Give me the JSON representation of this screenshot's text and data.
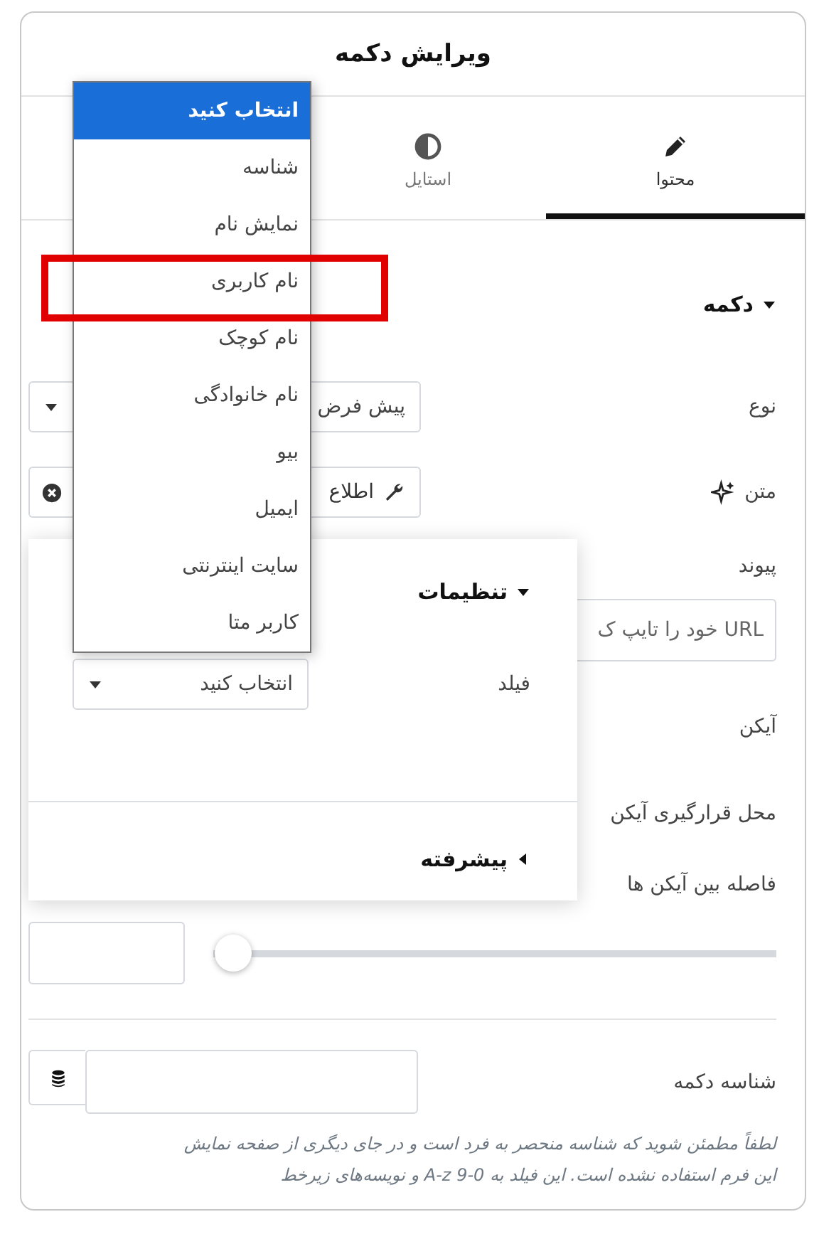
{
  "panel": {
    "title": "ویرایش دکمه"
  },
  "tabs": [
    {
      "label": "محتوا",
      "selected": true
    },
    {
      "label": "استایل",
      "selected": false
    }
  ],
  "section": {
    "title": "دکمه",
    "expanded": true
  },
  "type_field": {
    "label": "نوع",
    "value": "پیش فرض"
  },
  "text_field": {
    "label": "متن",
    "value": "اطلاع"
  },
  "link_field": {
    "label": "پیوند",
    "placeholder": "URL خود را تایپ ک"
  },
  "icon_label": "آیکن",
  "icon_position_label": "محل قرارگیری آیکن",
  "icon_spacing": {
    "label": "فاصله بین آیکن ها",
    "level": 0
  },
  "button_id": {
    "label": "شناسه دکمه",
    "help": "لطفاً مطمئن شوید که شناسه منحصر به فرد است و در جای دیگری از صفحه نمایش این فرم استفاده نشده است. این فیلد به 0-9  A-z و نویسه‌های زیرخط"
  },
  "popup": {
    "title": "تنظیمات",
    "expanded": true,
    "field_label": "فیلد",
    "field_value": "انتخاب کنید",
    "advanced": {
      "title": "پیشرفته",
      "expanded": false
    }
  },
  "dropdown": {
    "options": [
      {
        "label": "انتخاب کنید",
        "selected": true
      },
      {
        "label": "شناسه",
        "selected": false
      },
      {
        "label": "نمایش نام",
        "selected": false
      },
      {
        "label": "نام کاربری",
        "selected": false
      },
      {
        "label": "نام کوچک",
        "selected": false
      },
      {
        "label": "نام خانوادگی",
        "selected": false
      },
      {
        "label": "بیو",
        "selected": false
      },
      {
        "label": "ایمیل",
        "selected": false
      },
      {
        "label": "سایت اینترنتی",
        "selected": false
      },
      {
        "label": "کاربر متا",
        "selected": false
      }
    ]
  }
}
